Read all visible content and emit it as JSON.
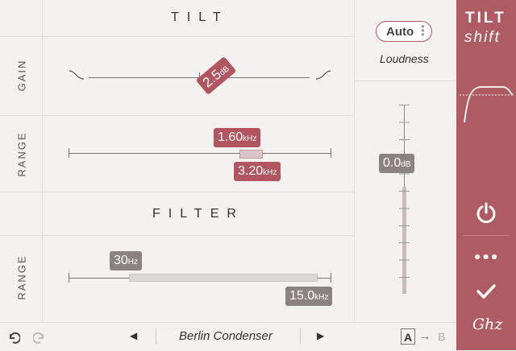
{
  "tilt": {
    "title": "TILT"
  },
  "gain": {
    "label": "GAIN",
    "value": "2.5",
    "unit": "dB"
  },
  "range1": {
    "label": "RANGE",
    "low": "1.60",
    "low_unit": "kHz",
    "high": "3.20",
    "high_unit": "kHz"
  },
  "filter": {
    "title": "FILTER"
  },
  "range2": {
    "label": "RANGE",
    "low": "30",
    "low_unit": "Hz",
    "high": "15.0",
    "high_unit": "kHz"
  },
  "loudness": {
    "auto_label": "Auto",
    "label": "Loudness",
    "value": "0.0",
    "unit": "dB"
  },
  "brand": {
    "line1": "TILT",
    "line2": "shift",
    "logo": "Ghz"
  },
  "bottom": {
    "preset": "Berlin Condenser",
    "a": "A",
    "b": "B"
  },
  "colors": {
    "accent": "#ae5b64",
    "badge_red": "#b35560",
    "badge_grey": "#8a8382"
  }
}
